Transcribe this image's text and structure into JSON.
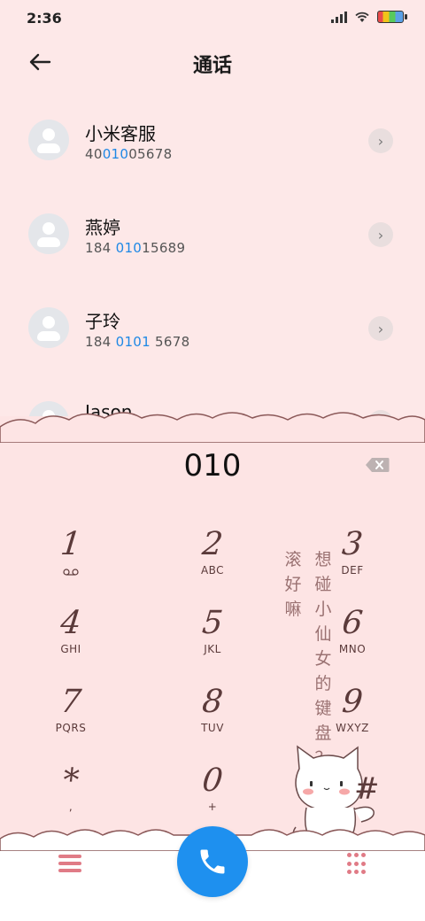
{
  "status": {
    "time": "2:36"
  },
  "header": {
    "title": "通话"
  },
  "contacts": [
    {
      "name": "小米客服",
      "num_pre": "40",
      "num_hl": "010",
      "num_post": "05678"
    },
    {
      "name": "燕婷",
      "num_pre": "184 ",
      "num_hl": "010",
      "num_post": "15689"
    },
    {
      "name": "子玲",
      "num_pre": "184 ",
      "num_hl": "0101",
      "num_post": " 5678"
    },
    {
      "name": "Jason",
      "num_pre": "",
      "num_hl": "",
      "num_post": ""
    }
  ],
  "dialer": {
    "input": "010",
    "keys": [
      {
        "digit": "1",
        "letters": ""
      },
      {
        "digit": "2",
        "letters": "ABC"
      },
      {
        "digit": "3",
        "letters": "DEF"
      },
      {
        "digit": "4",
        "letters": "GHI"
      },
      {
        "digit": "5",
        "letters": "JKL"
      },
      {
        "digit": "6",
        "letters": "MNO"
      },
      {
        "digit": "7",
        "letters": "PQRS"
      },
      {
        "digit": "8",
        "letters": "TUV"
      },
      {
        "digit": "9",
        "letters": "WXYZ"
      },
      {
        "digit": "*",
        "letters": ","
      },
      {
        "digit": "0",
        "letters": "+"
      },
      {
        "digit": "#",
        "letters": ""
      }
    ]
  },
  "decor": {
    "text_left": [
      "滚",
      "好",
      "嘛"
    ],
    "text_right": [
      "想",
      "碰",
      "小",
      "仙",
      "女",
      "的",
      "键",
      "盘",
      "？"
    ]
  },
  "icons": {
    "back": "arrow-left-icon",
    "chevron": "chevron-right-icon",
    "delete": "backspace-icon",
    "call": "phone-icon",
    "menu": "menu-icon",
    "keypad": "keypad-icon",
    "voicemail": "voicemail-icon"
  },
  "colors": {
    "accent": "#1e90ef",
    "highlight": "#1e88e5",
    "background": "#fde8e8",
    "key_text": "#5b3a3a"
  }
}
